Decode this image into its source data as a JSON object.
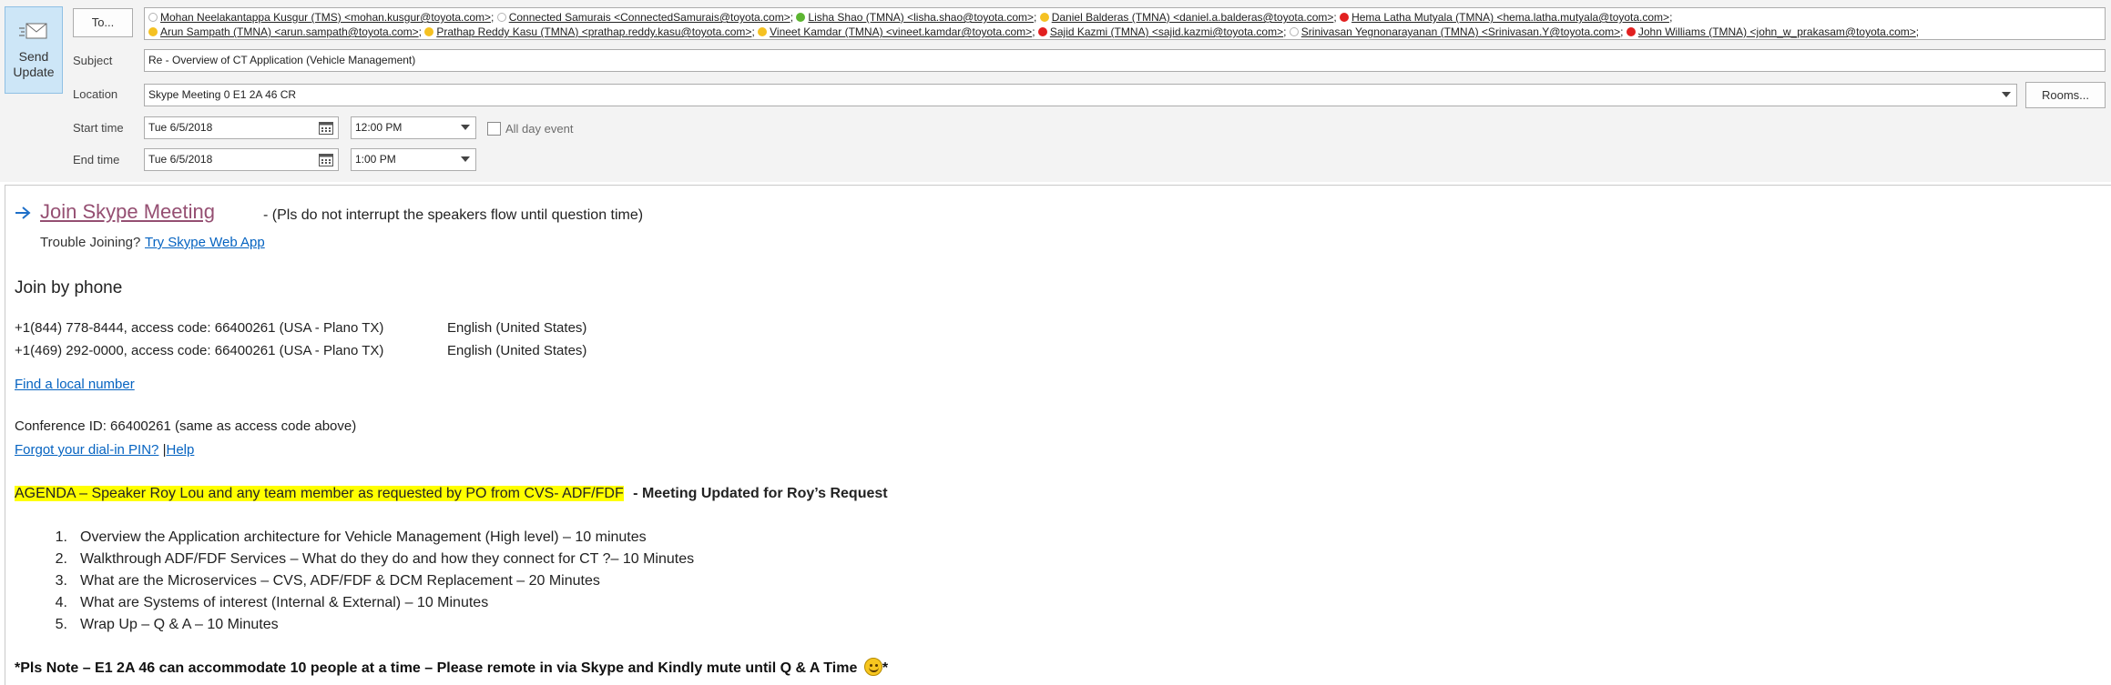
{
  "header": {
    "send_button": {
      "label_line1": "Send",
      "label_line2": "Update",
      "icon": "send-update-icon"
    },
    "to_button": {
      "label": "To..."
    },
    "recipients_line1": [
      {
        "name": "Mohan Neelakantappa Kusgur (TMS) <mohan.kusgur@toyota.com>",
        "presence": "offline"
      },
      {
        "name": "Connected Samurais <ConnectedSamurais@toyota.com>",
        "presence": "offline"
      },
      {
        "name": "Lisha Shao (TMNA) <lisha.shao@toyota.com>",
        "presence": "green"
      },
      {
        "name": "Daniel Balderas (TMNA) <daniel.a.balderas@toyota.com>",
        "presence": "yellow"
      },
      {
        "name": "Hema Latha Mutyala (TMNA) <hema.latha.mutyala@toyota.com>",
        "presence": "red"
      }
    ],
    "recipients_line2": [
      {
        "name": "Arun Sampath (TMNA) <arun.sampath@toyota.com>",
        "presence": "yellow"
      },
      {
        "name": "Prathap Reddy Kasu (TMNA) <prathap.reddy.kasu@toyota.com>",
        "presence": "yellow"
      },
      {
        "name": "Vineet Kamdar (TMNA) <vineet.kamdar@toyota.com>",
        "presence": "yellow"
      },
      {
        "name": "Sajid Kazmi (TMNA) <sajid.kazmi@toyota.com>",
        "presence": "red"
      },
      {
        "name": "Srinivasan Yegnonarayanan (TMNA) <Srinivasan.Y@toyota.com>",
        "presence": "offline"
      },
      {
        "name": "John Williams (TMNA) <john_w_prakasam@toyota.com>",
        "presence": "red"
      }
    ],
    "subject_label": "Subject",
    "subject_value": "Re - Overview of CT Application (Vehicle Management)",
    "location_label": "Location",
    "location_value": "Skype Meeting 0 E1 2A 46 CR",
    "rooms_button": "Rooms...",
    "start_label": "Start time",
    "start_date": "Tue 6/5/2018",
    "start_time": "12:00 PM",
    "all_day_label": "All day event",
    "end_label": "End time",
    "end_date": "Tue 6/5/2018",
    "end_time": "1:00 PM"
  },
  "body": {
    "join_link": "Join Skype Meeting",
    "join_note": "- (Pls do not interrupt the speakers flow until question time)",
    "trouble_text": "Trouble Joining?",
    "web_app_link": "Try Skype Web App",
    "phone_heading": "Join by phone",
    "phone_lines": [
      {
        "number": "+1(844) 778-8444, access code: 66400261 (USA - Plano TX)",
        "language": "English (United States)"
      },
      {
        "number": "+1(469) 292-0000, access code: 66400261 (USA - Plano TX)",
        "language": "English (United States)"
      }
    ],
    "local_number_link": "Find a local number",
    "conference_id": "Conference ID: 66400261 (same as access code above)",
    "forgot_pin_link": "Forgot your dial-in PIN?",
    "pipe": "|",
    "help_link": "Help",
    "agenda_highlight": "AGENDA – Speaker Roy Lou and any team member as requested by PO from CVS- ADF/FDF",
    "agenda_update": " - Meeting Updated for Roy’s Request",
    "agenda_items": [
      {
        "num": "1.",
        "text": "Overview the Application architecture for Vehicle Management (High level) – 10 minutes"
      },
      {
        "num": "2.",
        "text": "Walkthrough ADF/FDF Services – What do they do and how they connect for CT ?– 10 Minutes"
      },
      {
        "num": "3.",
        "text": "What are the Microservices – CVS, ADF/FDF & DCM Replacement – 20 Minutes"
      },
      {
        "num": "4.",
        "text": "What are Systems of interest (Internal & External) – 10 Minutes"
      },
      {
        "num": "5.",
        "text": "Wrap Up – Q & A – 10 Minutes"
      }
    ],
    "note": "*Pls Note – E1 2A 46 can accommodate 10 people at a time – Please remote in via Skype and Kindly mute until Q & A Time",
    "note_emoji": "😊",
    "note_end": "*"
  }
}
